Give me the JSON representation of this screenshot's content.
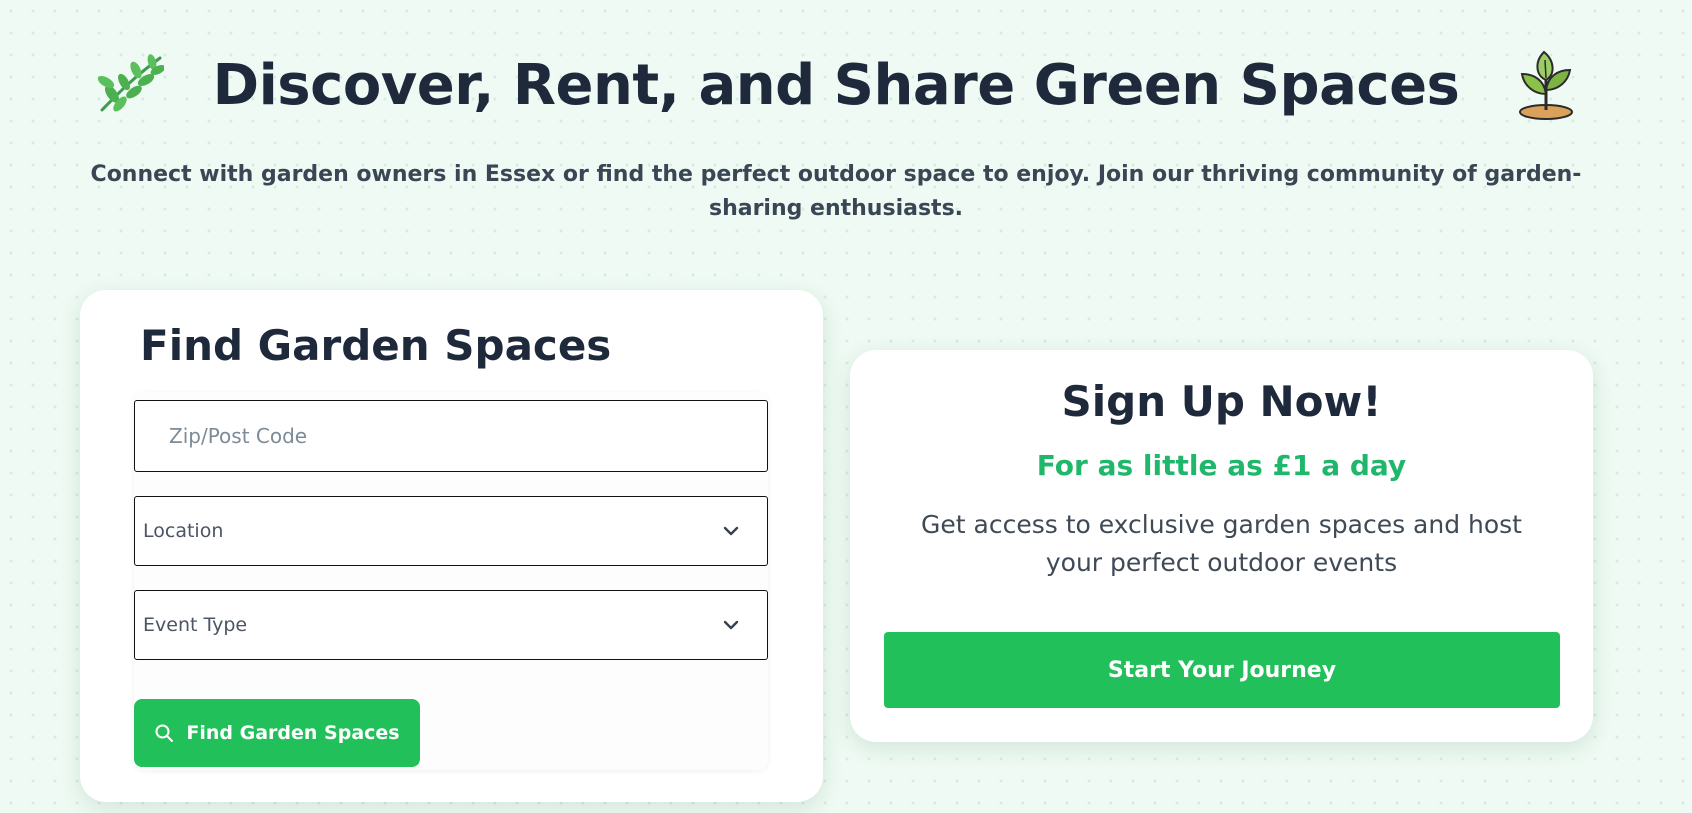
{
  "hero": {
    "title": "Discover, Rent, and Share Green Spaces",
    "subtitle": "Connect with garden owners in Essex or find the perfect outdoor space to enjoy. Join our thriving community of garden-sharing enthusiasts.",
    "left_icon": "sprig-leaf-icon",
    "right_icon": "sprout-plant-icon"
  },
  "search": {
    "title": "Find Garden Spaces",
    "zip_placeholder": "Zip/Post Code",
    "zip_value": "",
    "location_selected": "Location",
    "event_type_selected": "Event Type",
    "dropdown_icon": "chevron-down-icon",
    "button_icon": "search-icon",
    "button_label": "Find Garden Spaces"
  },
  "signup": {
    "title": "Sign Up Now!",
    "price_text": "For as little as £1 a day",
    "description": "Get access to exclusive garden spaces and host your perfect outdoor events",
    "button_label": "Start Your Journey"
  },
  "colors": {
    "page_background": "#eefaf3",
    "accent_green": "#22c05a",
    "price_green": "#1fb76a",
    "heading_dark": "#1e293b",
    "body_text": "#3f4a56"
  }
}
